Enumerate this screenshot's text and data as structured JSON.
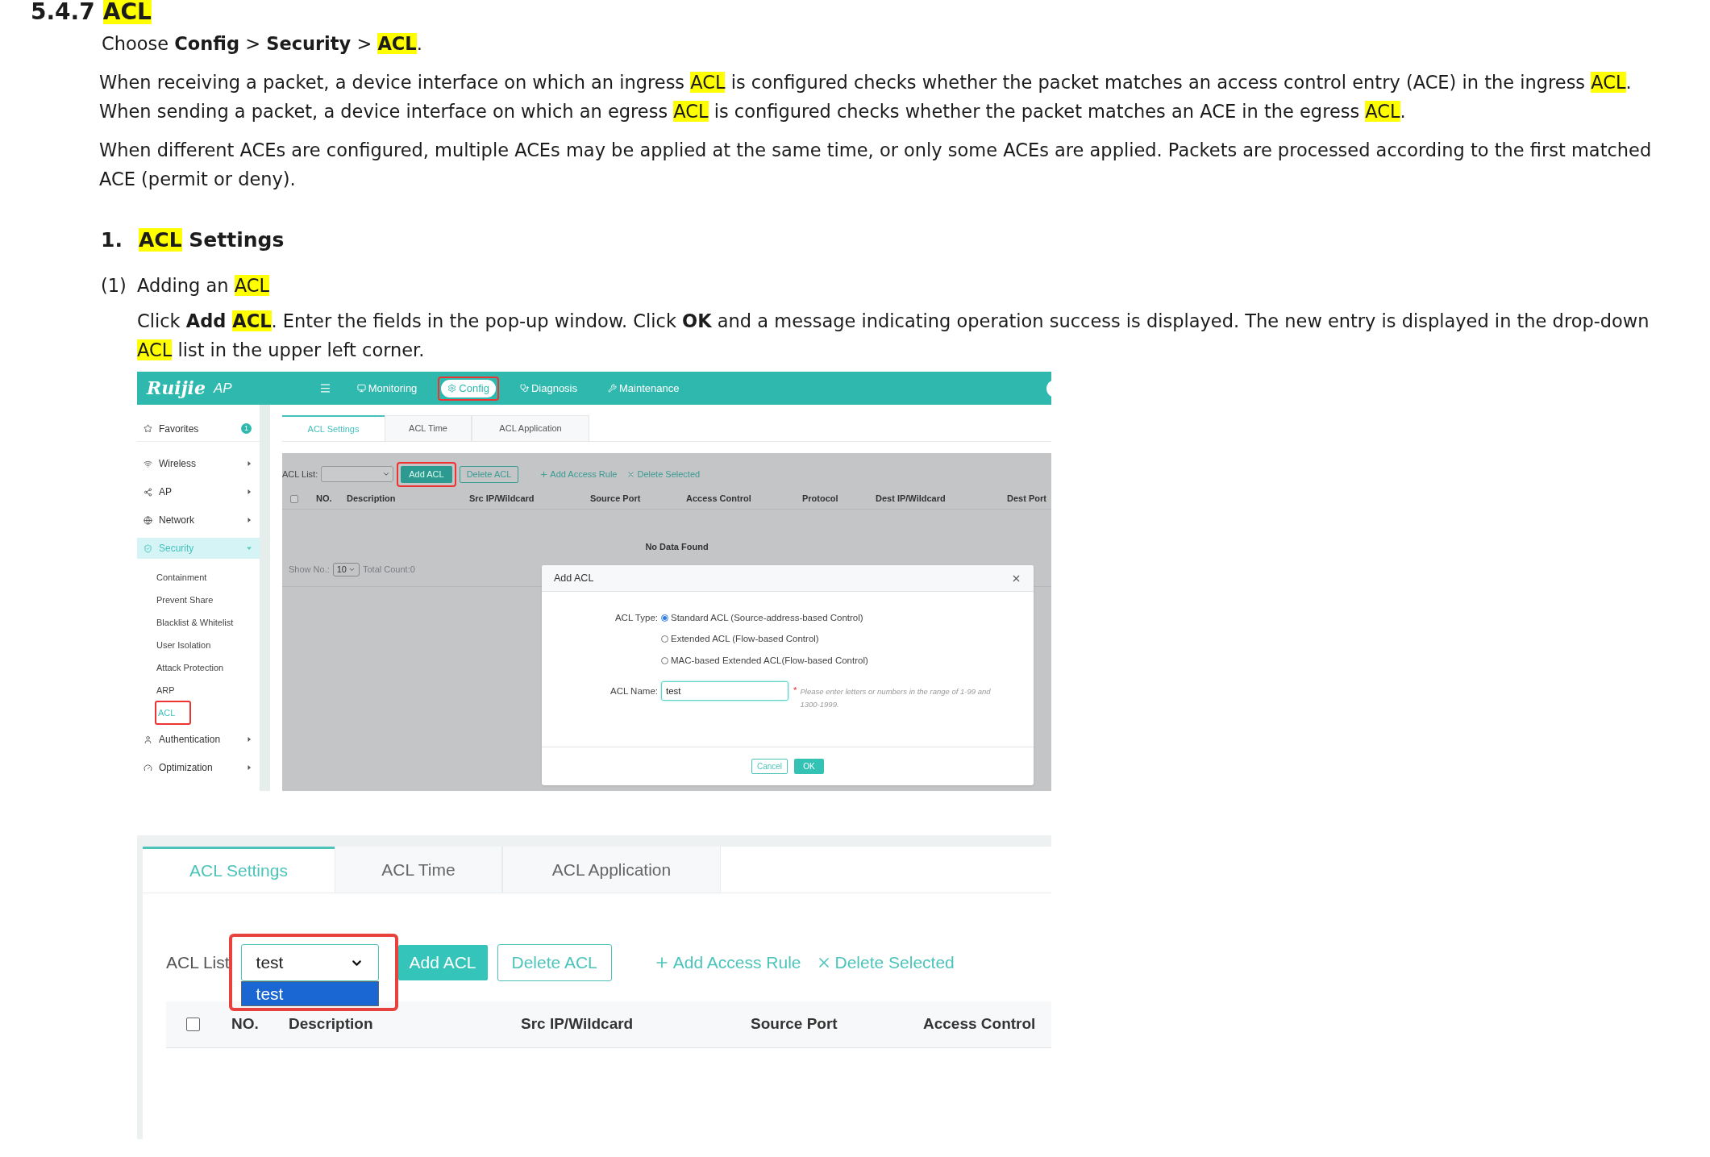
{
  "heading": {
    "number": "5.4.7",
    "title": "ACL"
  },
  "intro": [
    {
      "segments": [
        {
          "text": "Choose "
        },
        {
          "text": "Config",
          "bold": true
        },
        {
          "text": " > "
        },
        {
          "text": "Security",
          "bold": true
        },
        {
          "text": " > "
        },
        {
          "text": "ACL",
          "bold": true,
          "highlight": true
        },
        {
          "text": "."
        }
      ]
    },
    {
      "segments": [
        {
          "text": "When receiving a packet, a device interface on which an ingress "
        },
        {
          "text": "ACL",
          "highlight": true
        },
        {
          "text": " is configured checks whether the packet matches an access control entry (ACE) in the ingress "
        },
        {
          "text": "ACL",
          "highlight": true
        },
        {
          "text": ". When sending a packet, a device interface on which an egress "
        },
        {
          "text": "ACL",
          "highlight": true
        },
        {
          "text": " is configured checks whether the packet matches an ACE in the egress "
        },
        {
          "text": "ACL",
          "highlight": true
        },
        {
          "text": "."
        }
      ]
    },
    {
      "segments": [
        {
          "text": "When different ACEs are configured, multiple ACEs may be applied at the same time, or only some ACEs are applied. Packets are processed according to the first matched ACE (permit or deny)."
        }
      ]
    }
  ],
  "section": {
    "number": "1.",
    "segments": [
      {
        "text": "ACL",
        "highlight": true
      },
      {
        "text": " Settings"
      }
    ]
  },
  "step": {
    "number": "(1)",
    "segments": [
      {
        "text": "Adding an "
      },
      {
        "text": "ACL",
        "highlight": true
      }
    ]
  },
  "step_text": {
    "segments": [
      {
        "text": "Click "
      },
      {
        "text": "Add ",
        "bold": true
      },
      {
        "text": "ACL",
        "bold": true,
        "highlight": true
      },
      {
        "text": ". Enter the fields in the pop-up window. Click "
      },
      {
        "text": "OK",
        "bold": true
      },
      {
        "text": " and a message indicating operation success is displayed. The new entry is displayed in the drop-down "
      },
      {
        "text": "ACL",
        "highlight": true
      },
      {
        "text": " list in the upper left corner."
      }
    ]
  },
  "screenshot_1": {
    "header": {
      "logo": "Ruijie",
      "product": "AP",
      "nav": [
        {
          "label": "Monitoring",
          "selected": false,
          "callout": false
        },
        {
          "label": "Config",
          "selected": true,
          "callout": true
        },
        {
          "label": "Diagnosis",
          "selected": false,
          "callout": false
        },
        {
          "label": "Maintenance",
          "selected": false,
          "callout": false
        }
      ]
    },
    "sidebar": [
      {
        "label": "Favorites",
        "badge": "1"
      },
      {
        "label": "Wireless",
        "expanded": false,
        "selected": false
      },
      {
        "label": "AP",
        "expanded": false,
        "selected": false
      },
      {
        "label": "Network",
        "expanded": false,
        "selected": false
      },
      {
        "label": "Security",
        "expanded": true,
        "selected": true,
        "children": [
          {
            "label": "Containment",
            "selected": false,
            "callout": false
          },
          {
            "label": "Prevent Share",
            "selected": false,
            "callout": false
          },
          {
            "label": "Blacklist & Whitelist",
            "selected": false,
            "callout": false
          },
          {
            "label": "User Isolation",
            "selected": false,
            "callout": false
          },
          {
            "label": "Attack Protection",
            "selected": false,
            "callout": false
          },
          {
            "label": "ARP",
            "selected": false,
            "callout": false
          },
          {
            "label": "ACL",
            "selected": true,
            "callout": true
          }
        ]
      },
      {
        "label": "Authentication",
        "expanded": false,
        "selected": false
      },
      {
        "label": "Optimization",
        "expanded": false,
        "selected": false
      }
    ],
    "tabs": [
      {
        "label": "ACL Settings",
        "selected": true
      },
      {
        "label": "ACL Time",
        "selected": false
      },
      {
        "label": "ACL Application",
        "selected": false
      }
    ],
    "toolbar": {
      "list_label": "ACL List:",
      "add_button": {
        "label": "Add ACL",
        "callout": true
      },
      "delete_button": "Delete ACL",
      "add_rule": "Add Access Rule",
      "delete_selected": "Delete Selected"
    },
    "table": {
      "select_all_checked": false,
      "columns": [
        "NO.",
        "Description",
        "Src IP/Wildcard",
        "Source Port",
        "Access Control",
        "Protocol",
        "Dest IP/Wildcard",
        "Dest Port"
      ],
      "empty_message": "No Data Found"
    },
    "pagination": {
      "show_label": "Show No.:",
      "page_size": "10",
      "total": "Total Count:0"
    },
    "dialog": {
      "title": "Add ACL",
      "type_label": "ACL Type:",
      "types": [
        {
          "label": "Standard ACL (Source-address-based Control)",
          "selected": true
        },
        {
          "label": "Extended ACL (Flow-based Control)",
          "selected": false
        },
        {
          "label": "MAC-based Extended ACL(Flow-based Control)",
          "selected": false
        }
      ],
      "name_label": "ACL Name:",
      "name_value": "test",
      "required_mark": "*",
      "hint": "Please enter letters or numbers in the range of 1-99 and 1300-1999.",
      "cancel": "Cancel",
      "ok": "OK"
    }
  },
  "screenshot_2": {
    "tabs": [
      {
        "label": "ACL Settings",
        "selected": true
      },
      {
        "label": "ACL Time",
        "selected": false
      },
      {
        "label": "ACL Application",
        "selected": false
      }
    ],
    "list_label": "ACL List",
    "select": {
      "value": "test",
      "callout": true,
      "options": [
        {
          "label": "test",
          "selected": true
        }
      ]
    },
    "add_button": "Add ACL",
    "delete_button": "Delete ACL",
    "add_rule": "Add Access Rule",
    "delete_selected": "Delete Selected",
    "table": {
      "select_all_checked": false,
      "columns": [
        "NO.",
        "Description",
        "Src IP/Wildcard",
        "Source Port",
        "Access Control"
      ]
    }
  }
}
